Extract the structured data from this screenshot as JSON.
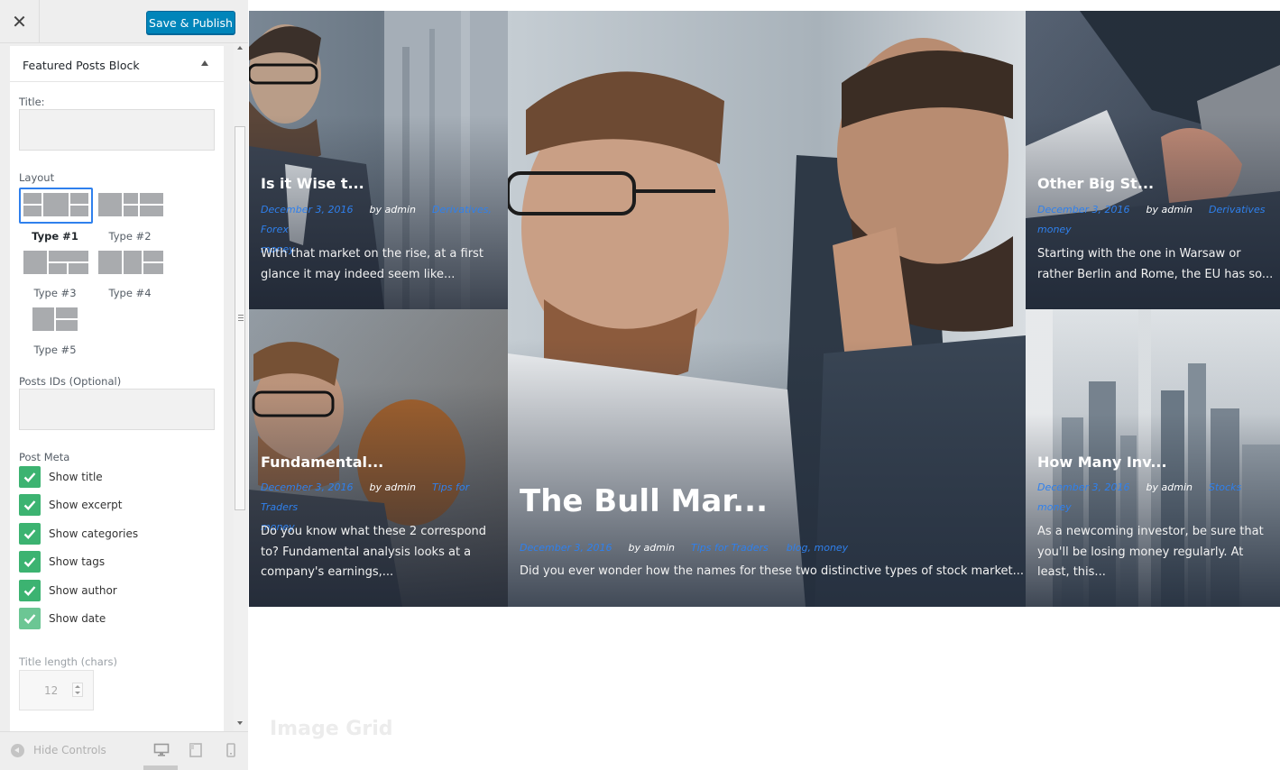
{
  "header": {
    "close_icon": "close-icon",
    "publish_label": "Save & Publish"
  },
  "section": {
    "title": "Featured Posts Block",
    "title_label": "Title:",
    "title_value": "",
    "layout_label": "Layout",
    "layouts": [
      {
        "label": "Type #1",
        "selected": true
      },
      {
        "label": "Type #2",
        "selected": false
      },
      {
        "label": "Type #3",
        "selected": false
      },
      {
        "label": "Type #4",
        "selected": false
      },
      {
        "label": "Type #5",
        "selected": false
      }
    ],
    "post_ids_label": "Posts IDs (Optional)",
    "post_ids_value": "",
    "post_meta_label": "Post Meta",
    "checkboxes": [
      {
        "label": "Show title",
        "checked": true
      },
      {
        "label": "Show excerpt",
        "checked": true
      },
      {
        "label": "Show categories",
        "checked": true
      },
      {
        "label": "Show tags",
        "checked": true
      },
      {
        "label": "Show author",
        "checked": true
      },
      {
        "label": "Show date",
        "checked": true
      }
    ],
    "title_length_label": "Title length (chars)",
    "title_length_value": "12"
  },
  "footer": {
    "hide_controls_label": "Hide Controls",
    "devices": [
      "desktop-icon",
      "tablet-icon",
      "mobile-icon"
    ],
    "active_device": "desktop-icon"
  },
  "colors": {
    "publish_bg": "#0085ba",
    "checkbox_green": "#3cb371",
    "selected_outline": "#2f80ed",
    "meta_link": "#2f80ed"
  },
  "posts": [
    {
      "title": "Is it Wise t...",
      "date": "December 3, 2016",
      "author": "by admin",
      "categories": "Derivatives, Forex",
      "categories_cont": "money",
      "excerpt": "With that market on the rise, at a first glance it may indeed seem like..."
    },
    {
      "title": "The Bull Mar...",
      "date": "December 3, 2016",
      "author": "by admin",
      "categories": "Tips for Traders",
      "tags": "blog, money",
      "excerpt": "Did you ever wonder how the names for these two distinctive types of stock market..."
    },
    {
      "title": "Other Big St...",
      "date": "December 3, 2016",
      "author": "by admin",
      "categories": "Derivatives",
      "categories_cont": "money",
      "excerpt": "Starting with the one in Warsaw or rather Berlin and Rome, the EU has so..."
    },
    {
      "title": "Fundamental...",
      "date": "December 3, 2016",
      "author": "by admin",
      "categories": "Tips for Traders",
      "categories_cont": "money",
      "excerpt": "Do you know what these 2 correspond to? Fundamental analysis looks at a company's earnings,..."
    },
    {
      "title": "How Many Inv...",
      "date": "December 3, 2016",
      "author": "by admin",
      "categories": "Stocks",
      "categories_cont": "money",
      "excerpt": "As a newcoming investor, be sure that you'll be losing money regularly. At least, this..."
    }
  ],
  "next_section_heading": "Image Grid"
}
